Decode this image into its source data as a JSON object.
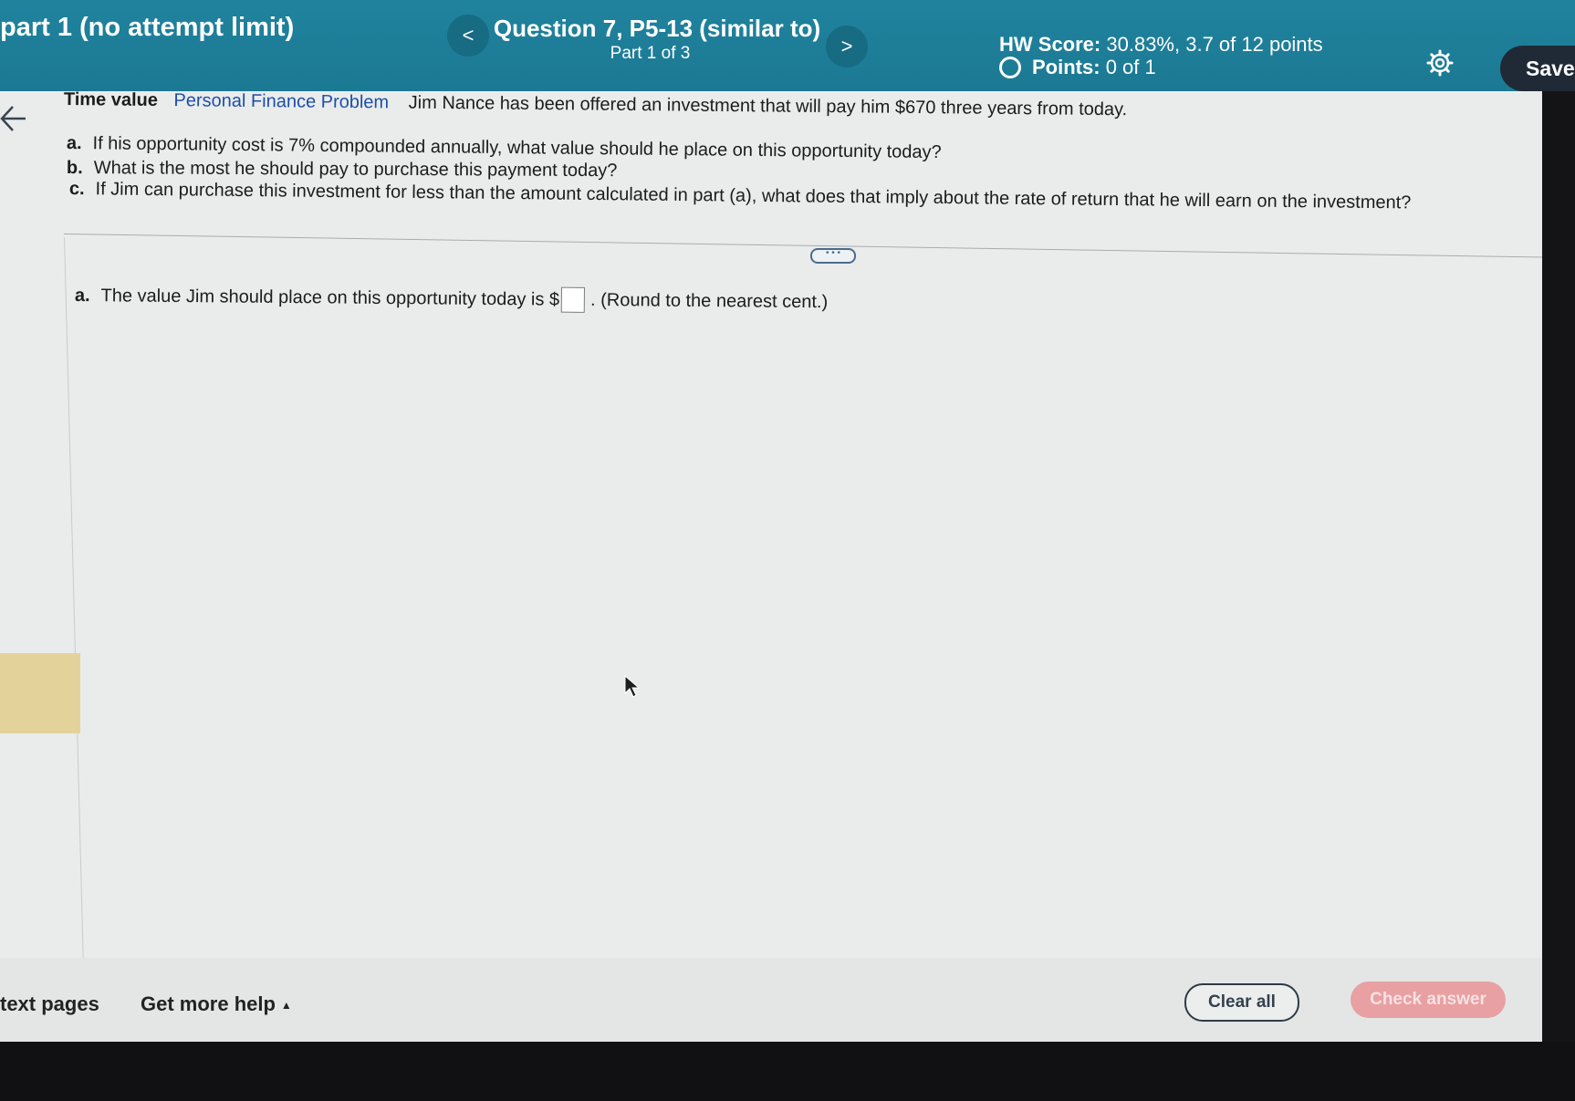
{
  "header": {
    "assignment_title": "part 1 (no attempt limit)",
    "question_title": "Question 7, P5-13 (similar to)",
    "question_part": "Part 1 of 3",
    "hw_score_label": "HW Score:",
    "hw_score_value": "30.83%, 3.7 of 12 points",
    "points_label": "Points:",
    "points_value": "0 of 1",
    "prev_label": "<",
    "next_label": ">",
    "save_label": "Save"
  },
  "problem": {
    "topic": "Time value",
    "category": "Personal Finance Problem",
    "intro": "Jim Nance has been offered an investment that will pay him $670 three years from today.",
    "parts": [
      {
        "letter": "a.",
        "text": "If his opportunity cost is 7% compounded annually, what value should he place on this opportunity today?"
      },
      {
        "letter": "b.",
        "text": "What is the most he should pay to purchase this payment today?"
      },
      {
        "letter": "c.",
        "text": "If Jim can purchase this investment for less than the amount calculated in part (a), what does that imply about the rate of return that he will earn on the investment?"
      }
    ]
  },
  "answer": {
    "letter": "a.",
    "prompt": "The value Jim should place on this opportunity today is $",
    "input_value": "",
    "suffix": ". (Round to the nearest cent.)"
  },
  "expand_label": "• • •",
  "footer": {
    "textbook_label": "text pages",
    "help_label": "Get more help",
    "help_caret": "▲",
    "clear_label": "Clear all",
    "check_label": "Check answer"
  },
  "icons": {
    "back": "arrow-left-icon",
    "settings": "gear-icon",
    "cursor": "mouse-cursor-icon"
  }
}
